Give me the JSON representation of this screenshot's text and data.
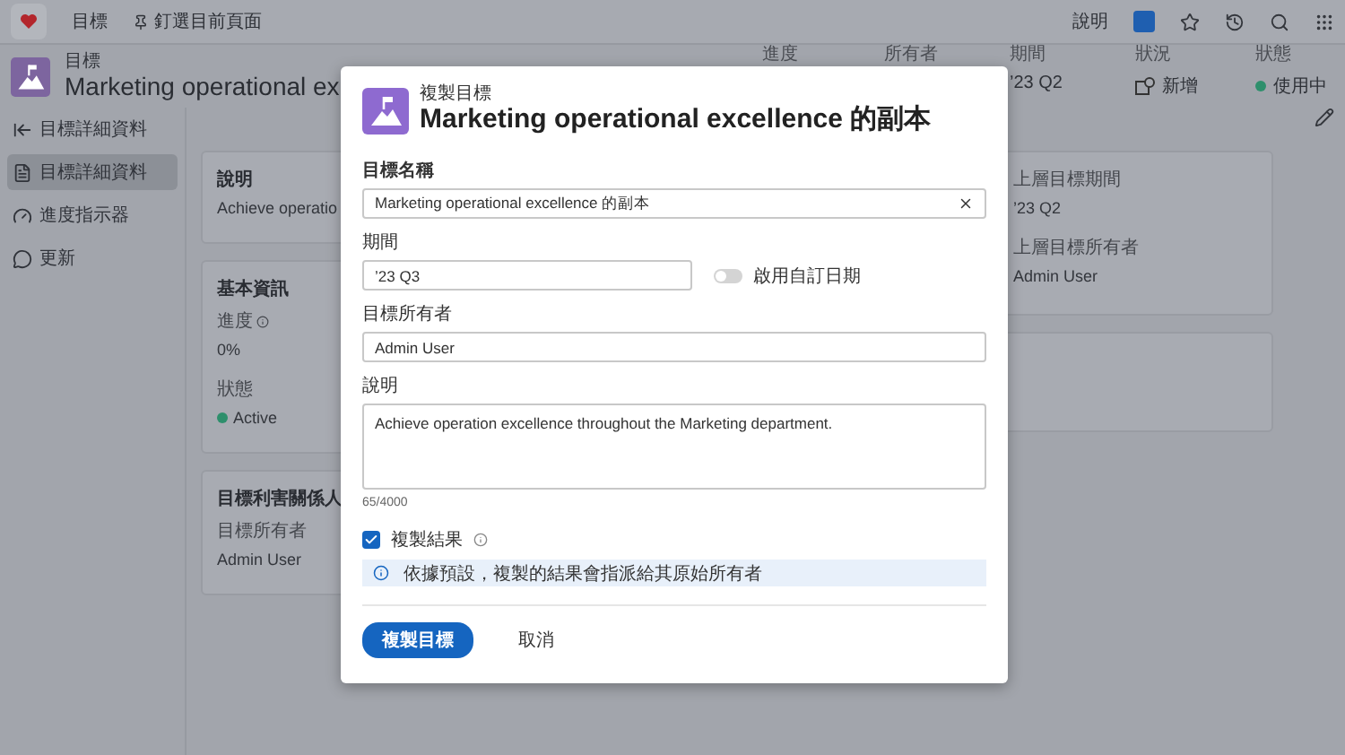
{
  "top_bar": {
    "nav": [
      {
        "label": "目標",
        "kind": "plain"
      },
      {
        "label": "釘選目前頁面",
        "kind": "pin"
      }
    ],
    "help": "說明"
  },
  "header": {
    "eyebrow": "目標",
    "title": "Marketing operational ex",
    "fields": [
      {
        "label": "進度"
      },
      {
        "label": "所有者"
      },
      {
        "label": "期間",
        "value": "’23 Q2",
        "kind": "text"
      },
      {
        "label": "狀況",
        "value": "新增",
        "kind": "new"
      },
      {
        "label": "狀態",
        "value": "使用中",
        "kind": "dot",
        "color": "#2e8f6c"
      }
    ]
  },
  "sidebar": {
    "back": "目標詳細資料",
    "items": [
      {
        "label": "目標詳細資料",
        "kind": "doc",
        "selected": true
      },
      {
        "label": "進度指示器",
        "kind": "meter",
        "selected": false
      },
      {
        "label": "更新",
        "kind": "chat",
        "selected": false
      }
    ]
  },
  "left_cards": [
    {
      "title": "說明",
      "fields": [
        {
          "value": "Achieve operatio"
        }
      ]
    },
    {
      "title": "基本資訊",
      "fields": [
        {
          "label": "進度",
          "info": true,
          "value": "0%"
        },
        {
          "label": "狀態",
          "value": "Active",
          "color": "#2e8f6c"
        }
      ]
    },
    {
      "title": "目標利害關係人",
      "fields": [
        {
          "label": "目標所有者",
          "value": "Admin User"
        }
      ]
    }
  ],
  "right_cards": [
    {
      "fields": [
        {
          "label": "上層目標期間",
          "value": "’23 Q2"
        },
        {
          "label": "上層目標所有者",
          "value": "Admin User"
        }
      ]
    },
    {
      "kind": "empty"
    }
  ],
  "dialog": {
    "eyebrow": "複製目標",
    "title": "Marketing operational excellence 的副本",
    "name_field": {
      "label": "目標名稱",
      "value": "Marketing operational excellence 的副本"
    },
    "period_field": {
      "label": "期間",
      "value": "’23 Q3"
    },
    "custom_dates": {
      "label": "啟用自訂日期",
      "on": false
    },
    "owner_field": {
      "label": "目標所有者",
      "value": "Admin User"
    },
    "description_field": {
      "label": "說明",
      "value": "Achieve operation excellence throughout the Marketing department.",
      "counter": "65/4000"
    },
    "copy_results": {
      "label": "複製結果",
      "checked": true
    },
    "notice": "依據預設，複製的結果會指派給其原始所有者",
    "buttons": [
      {
        "label": "複製目標",
        "kind": "primary"
      },
      {
        "label": "取消",
        "kind": "secondary"
      }
    ]
  }
}
